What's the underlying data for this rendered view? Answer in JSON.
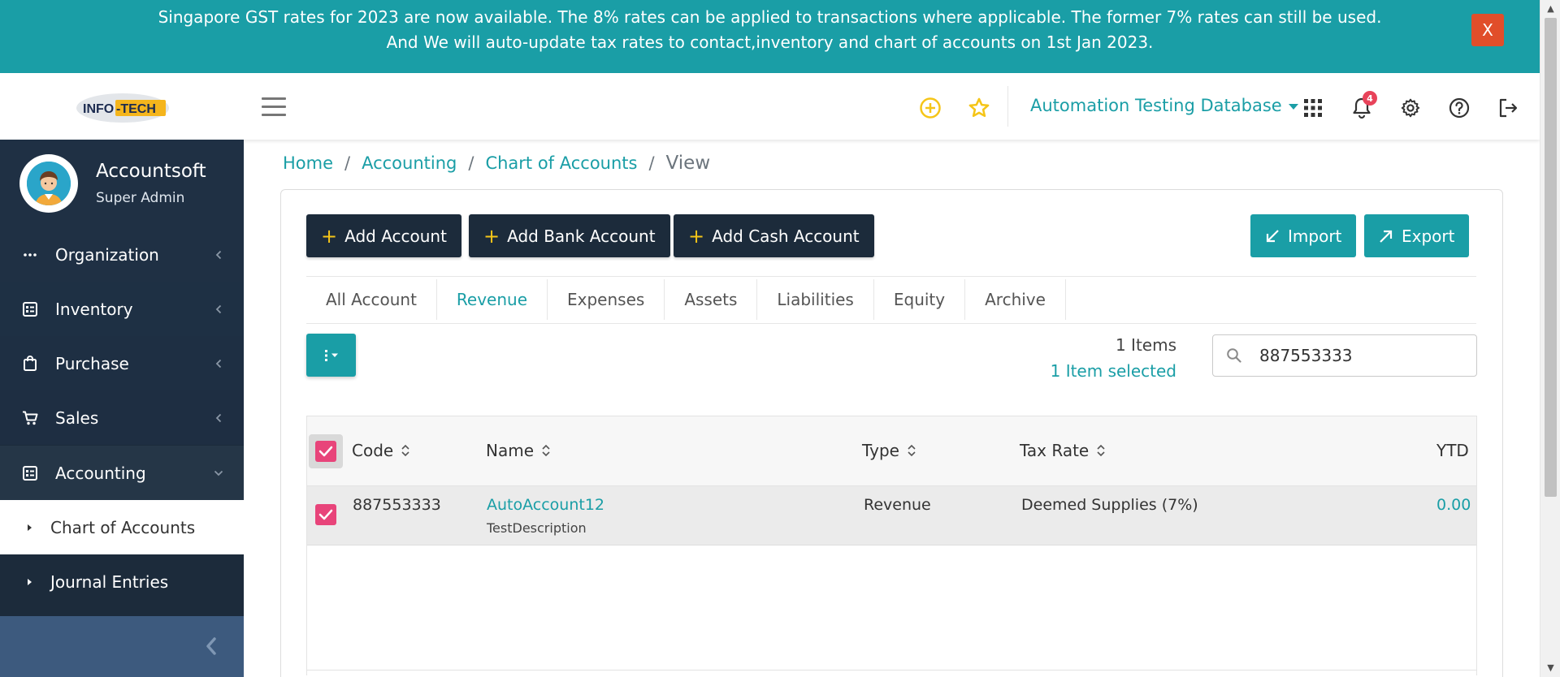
{
  "banner": {
    "line1": "Singapore GST rates for 2023 are now available. The 8% rates can be applied to transactions where applicable. The former 7% rates can still be used.",
    "line2": "And We will auto-update tax rates to contact,inventory and chart of accounts on 1st Jan 2023.",
    "close_label": "X"
  },
  "header": {
    "logo_text": "INFO-TECH",
    "database": "Automation Testing Database",
    "notification_count": "4"
  },
  "sidebar": {
    "user_name": "Accountsoft",
    "user_role": "Super Admin",
    "items": [
      {
        "label": "Organization",
        "icon": "dots-icon"
      },
      {
        "label": "Inventory",
        "icon": "inventory-icon"
      },
      {
        "label": "Purchase",
        "icon": "purchase-bag-icon"
      },
      {
        "label": "Sales",
        "icon": "cart-icon"
      },
      {
        "label": "Accounting",
        "icon": "accounting-icon"
      }
    ],
    "sub_items": [
      {
        "label": "Chart of Accounts"
      },
      {
        "label": "Journal Entries"
      }
    ]
  },
  "breadcrumb": {
    "items": [
      "Home",
      "Accounting",
      "Chart of Accounts"
    ],
    "current": "View"
  },
  "toolbar": {
    "add_account": "Add Account",
    "add_bank_account": "Add Bank Account",
    "add_cash_account": "Add Cash Account",
    "import": "Import",
    "export": "Export"
  },
  "tabs": [
    "All Account",
    "Revenue",
    "Expenses",
    "Assets",
    "Liabilities",
    "Equity",
    "Archive"
  ],
  "active_tab": "Revenue",
  "list": {
    "items_count": "1 Items",
    "items_selected": "1 Item selected",
    "search_value": "887553333"
  },
  "table": {
    "headers": {
      "code": "Code",
      "name": "Name",
      "type": "Type",
      "tax_rate": "Tax Rate",
      "ytd": "YTD"
    },
    "rows": [
      {
        "code": "887553333",
        "name": "AutoAccount12",
        "description": "TestDescription",
        "type": "Revenue",
        "tax_rate": "Deemed Supplies (7%)",
        "ytd": "0.00",
        "checked": true
      }
    ]
  },
  "colors": {
    "teal": "#1a9ea6",
    "navy": "#1c2b3b",
    "close_orange": "#e14e2a",
    "checkbox_pink": "#e8447a",
    "star_yellow": "#f5c518"
  }
}
